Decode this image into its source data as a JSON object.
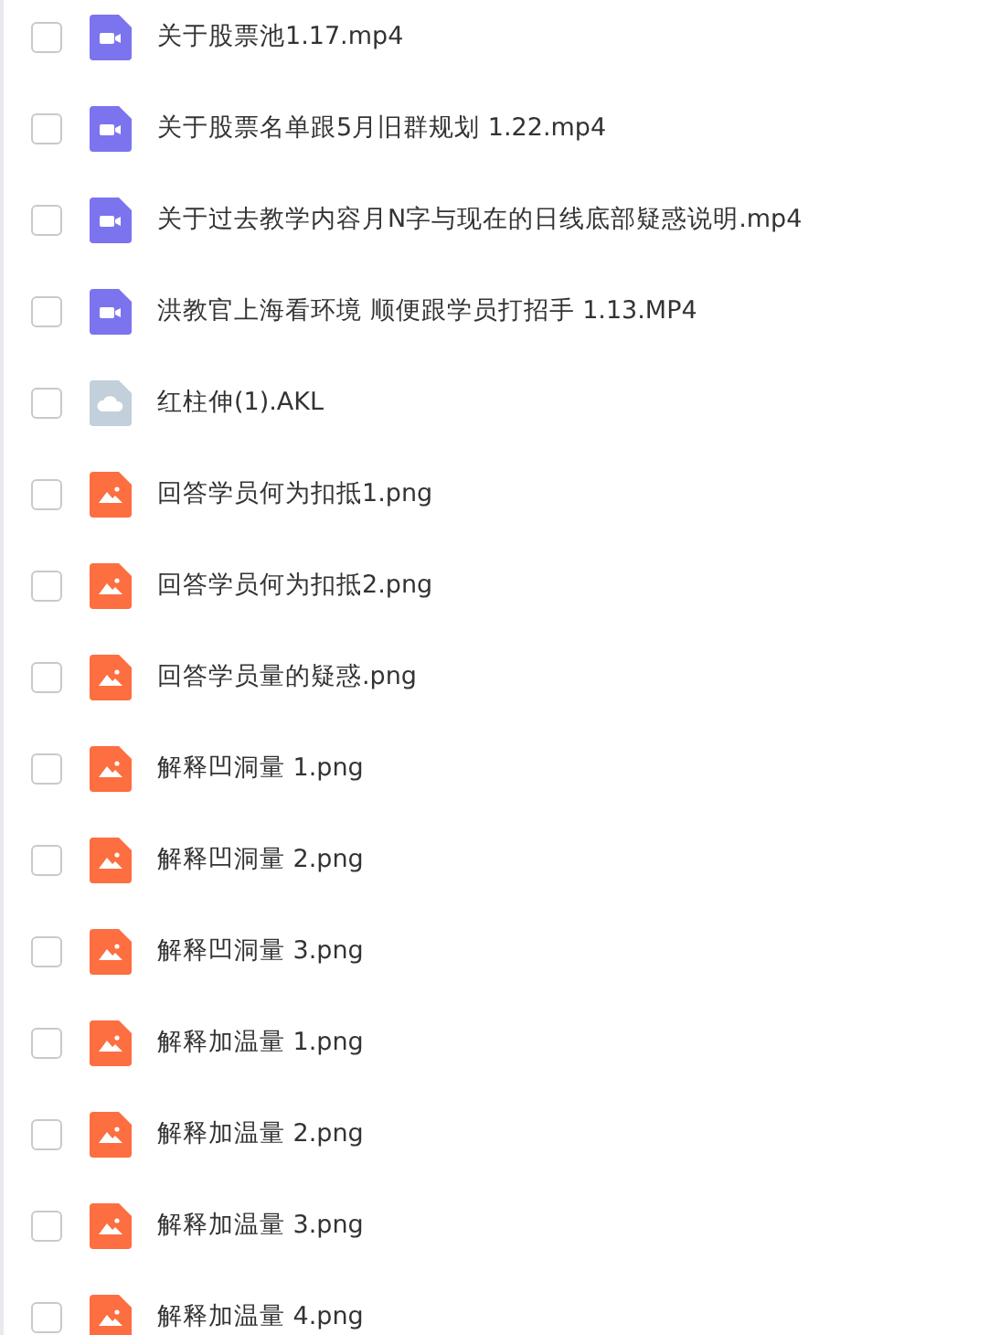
{
  "files": [
    {
      "name": "关于股票池1.17.mp4",
      "kind": "video",
      "checked": false
    },
    {
      "name": "关于股票名单跟5月旧群规划 1.22.mp4",
      "kind": "video",
      "checked": false
    },
    {
      "name": "关于过去教学内容月N字与现在的日线底部疑惑说明.mp4",
      "kind": "video",
      "checked": false
    },
    {
      "name": "洪教官上海看环境 顺便跟学员打招手 1.13.MP4",
      "kind": "video",
      "checked": false
    },
    {
      "name": "红柱伸(1).AKL",
      "kind": "cloud",
      "checked": false
    },
    {
      "name": "回答学员何为扣抵1.png",
      "kind": "image",
      "checked": false
    },
    {
      "name": "回答学员何为扣抵2.png",
      "kind": "image",
      "checked": false
    },
    {
      "name": "回答学员量的疑惑.png",
      "kind": "image",
      "checked": false
    },
    {
      "name": "解释凹洞量 1.png",
      "kind": "image",
      "checked": false
    },
    {
      "name": "解释凹洞量 2.png",
      "kind": "image",
      "checked": false
    },
    {
      "name": "解释凹洞量 3.png",
      "kind": "image",
      "checked": false
    },
    {
      "name": "解释加温量 1.png",
      "kind": "image",
      "checked": false
    },
    {
      "name": "解释加温量 2.png",
      "kind": "image",
      "checked": false
    },
    {
      "name": "解释加温量 3.png",
      "kind": "image",
      "checked": false
    },
    {
      "name": "解释加温量 4.png",
      "kind": "image",
      "checked": false
    }
  ]
}
